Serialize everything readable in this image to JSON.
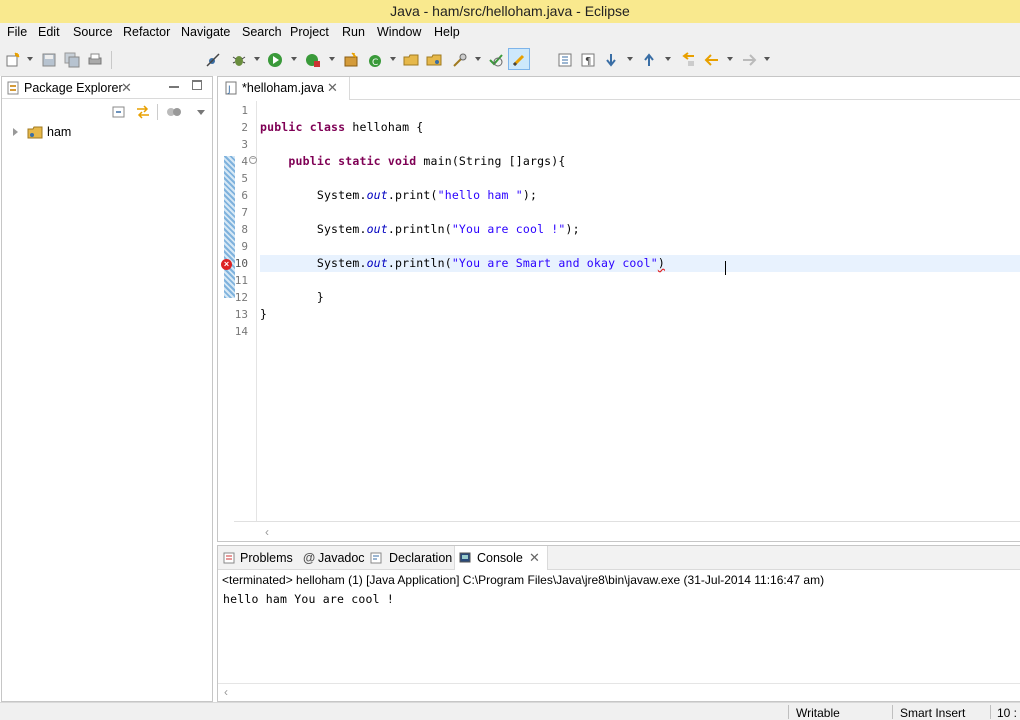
{
  "window": {
    "title": "Java - ham/src/helloham.java - Eclipse"
  },
  "menu": [
    "File",
    "Edit",
    "Source",
    "Refactor",
    "Navigate",
    "Search",
    "Project",
    "Run",
    "Window",
    "Help"
  ],
  "explorer": {
    "title": "Package Explorer",
    "tree": [
      {
        "label": "ham",
        "icon": "java-project-icon",
        "expanded": false
      }
    ]
  },
  "editor": {
    "tab_label": "*helloham.java",
    "line_numbers": [
      "1",
      "2",
      "3",
      "4",
      "5",
      "6",
      "7",
      "8",
      "9",
      "10",
      "11",
      "12",
      "13",
      "14"
    ],
    "code": {
      "l2_kw1": "public",
      "l2_kw2": "class",
      "l2_rest": " helloham {",
      "l4_kw1": "public",
      "l4_kw2": "static",
      "l4_kw3": "void",
      "l4_rest": " main(String []args){",
      "l6_a": "System.",
      "l6_field": "out",
      "l6_b": ".print(",
      "l6_str": "\"hello ham \"",
      "l6_c": ");",
      "l8_a": "System.",
      "l8_field": "out",
      "l8_b": ".println(",
      "l8_str": "\"You are cool !\"",
      "l8_c": ");",
      "l10_a": "System.",
      "l10_field": "out",
      "l10_b": ".println(",
      "l10_str": "\"You are Smart and okay cool\"",
      "l10_c": ")",
      "l12": "}",
      "l13": "}"
    },
    "error_line": "10"
  },
  "bottom": {
    "tabs": [
      "Problems",
      "Javadoc",
      "Declaration",
      "Console"
    ],
    "active_tab": "Console",
    "console_description": "<terminated> helloham (1) [Java Application] C:\\Program Files\\Java\\jre8\\bin\\javaw.exe (31-Jul-2014 11:16:47 am)",
    "console_output": "hello ham You are cool !"
  },
  "status": {
    "writable": "Writable",
    "insert_mode": "Smart Insert",
    "position": "10 :"
  },
  "colors": {
    "titlebar": "#f9e98e",
    "keyword": "#7f0055",
    "string": "#2a00ff",
    "field": "#0000c0",
    "current_line": "#e8f2fe"
  }
}
